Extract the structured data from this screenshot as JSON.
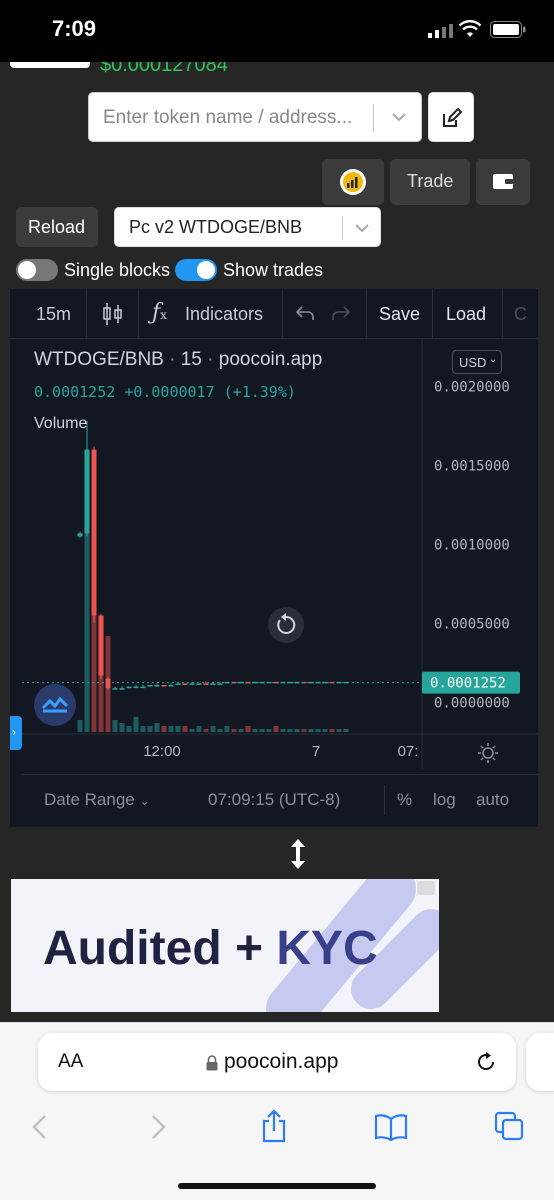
{
  "status_bar": {
    "time": "7:09"
  },
  "header": {
    "token_price": "$0.000127084",
    "search_placeholder": "Enter token name / address..."
  },
  "controls": {
    "trade_label": "Trade",
    "reload_label": "Reload",
    "pair_select": "Pc v2 WTDOGE/BNB",
    "single_blocks_label": "Single blocks",
    "single_blocks_on": false,
    "show_trades_label": "Show trades",
    "show_trades_on": true
  },
  "chart_toolbar": {
    "interval": "15m",
    "indicators_label": "Indicators",
    "save_label": "Save",
    "load_label": "Load",
    "overflow_letter": "C"
  },
  "chart_legend": {
    "symbol": "WTDOGE/BNB",
    "dot1": "·",
    "interval": "15",
    "dot2": "·",
    "source": "poocoin.app",
    "price": "0.0001252",
    "change": "+0.0000017",
    "change_pct": "(+1.39%)",
    "volume_label": "Volume",
    "currency_button": "USD"
  },
  "chart_data": {
    "type": "candlestick",
    "y_ticks": [
      "0.0020000",
      "0.0015000",
      "0.0010000",
      "0.0005000",
      "0.0000000"
    ],
    "current_price_label": "0.0001252",
    "x_tick_labels": [
      "12:00",
      "7",
      "07:"
    ],
    "ylim": [
      -0.0002,
      0.0023
    ],
    "candles": [
      {
        "o": 0.00105,
        "c": 0.00107,
        "h": 0.00108,
        "l": 0.00104,
        "up": true
      },
      {
        "o": 0.00107,
        "c": 0.0016,
        "h": 0.00178,
        "l": 0.00105,
        "up": true
      },
      {
        "o": 0.0016,
        "c": 0.00055,
        "h": 0.00162,
        "l": 0.0005,
        "up": false
      },
      {
        "o": 0.00055,
        "c": 0.00017,
        "h": 0.00056,
        "l": 0.00015,
        "up": false
      },
      {
        "o": 0.00015,
        "c": 9e-05,
        "h": 0.00016,
        "l": 8e-05,
        "up": false
      },
      {
        "o": 9e-05,
        "c": 9e-05,
        "h": 0.0001,
        "l": 8e-05,
        "up": true
      },
      {
        "o": 9e-05,
        "c": 9e-05,
        "h": 0.0001,
        "l": 8e-05,
        "up": true
      },
      {
        "o": 9e-05,
        "c": 0.0001,
        "h": 0.0001,
        "l": 9e-05,
        "up": true
      },
      {
        "o": 0.0001,
        "c": 0.0001,
        "h": 0.00011,
        "l": 9e-05,
        "up": true
      },
      {
        "o": 0.0001,
        "c": 0.0001,
        "h": 0.00011,
        "l": 0.0001,
        "up": true
      },
      {
        "o": 0.0001,
        "c": 0.00011,
        "h": 0.00011,
        "l": 0.0001,
        "up": true
      },
      {
        "o": 0.00011,
        "c": 0.00011,
        "h": 0.00012,
        "l": 0.0001,
        "up": true
      },
      {
        "o": 0.00011,
        "c": 0.00011,
        "h": 0.00011,
        "l": 0.0001,
        "up": false
      },
      {
        "o": 0.00011,
        "c": 0.00011,
        "h": 0.00012,
        "l": 0.00011,
        "up": true
      },
      {
        "o": 0.00011,
        "c": 0.00012,
        "h": 0.00012,
        "l": 0.00011,
        "up": true
      },
      {
        "o": 0.00012,
        "c": 0.00012,
        "h": 0.00012,
        "l": 0.00011,
        "up": false
      },
      {
        "o": 0.00012,
        "c": 0.00012,
        "h": 0.00013,
        "l": 0.00011,
        "up": true
      },
      {
        "o": 0.00012,
        "c": 0.00012,
        "h": 0.00012,
        "l": 0.00012,
        "up": true
      },
      {
        "o": 0.00012,
        "c": 0.00012,
        "h": 0.00013,
        "l": 0.00012,
        "up": false
      },
      {
        "o": 0.00012,
        "c": 0.00012,
        "h": 0.00013,
        "l": 0.00012,
        "up": true
      },
      {
        "o": 0.00012,
        "c": 0.00012,
        "h": 0.00013,
        "l": 0.00012,
        "up": true
      },
      {
        "o": 0.00012,
        "c": 0.00013,
        "h": 0.00013,
        "l": 0.00012,
        "up": true
      },
      {
        "o": 0.00013,
        "c": 0.00013,
        "h": 0.00013,
        "l": 0.00012,
        "up": false
      },
      {
        "o": 0.00013,
        "c": 0.00013,
        "h": 0.00013,
        "l": 0.00012,
        "up": true
      },
      {
        "o": 0.00013,
        "c": 0.00013,
        "h": 0.00013,
        "l": 0.00012,
        "up": false
      },
      {
        "o": 0.00013,
        "c": 0.00013,
        "h": 0.00013,
        "l": 0.00012,
        "up": true
      },
      {
        "o": 0.00013,
        "c": 0.00013,
        "h": 0.00013,
        "l": 0.00012,
        "up": true
      },
      {
        "o": 0.00013,
        "c": 0.00013,
        "h": 0.00013,
        "l": 0.00013,
        "up": true
      },
      {
        "o": 0.00013,
        "c": 0.00013,
        "h": 0.00013,
        "l": 0.00012,
        "up": false
      },
      {
        "o": 0.00013,
        "c": 0.00013,
        "h": 0.00013,
        "l": 0.00012,
        "up": true
      },
      {
        "o": 0.00013,
        "c": 0.00013,
        "h": 0.00013,
        "l": 0.00013,
        "up": true
      },
      {
        "o": 0.00013,
        "c": 0.00013,
        "h": 0.00013,
        "l": 0.00013,
        "up": true
      },
      {
        "o": 0.00013,
        "c": 0.00013,
        "h": 0.00013,
        "l": 0.00012,
        "up": false
      },
      {
        "o": 0.00013,
        "c": 0.00013,
        "h": 0.00013,
        "l": 0.00013,
        "up": true
      },
      {
        "o": 0.00013,
        "c": 0.00013,
        "h": 0.00013,
        "l": 0.00013,
        "up": true
      },
      {
        "o": 0.00013,
        "c": 0.00013,
        "h": 0.00013,
        "l": 0.00013,
        "up": true
      },
      {
        "o": 0.00013,
        "c": 0.00013,
        "h": 0.00013,
        "l": 0.00013,
        "up": false
      },
      {
        "o": 0.00013,
        "c": 0.00013,
        "h": 0.00013,
        "l": 0.00013,
        "up": true
      },
      {
        "o": 0.00013,
        "c": 0.00013,
        "h": 0.00013,
        "l": 0.00013,
        "up": true
      }
    ],
    "volumes": [
      0.04,
      0.75,
      0.55,
      0.38,
      0.32,
      0.04,
      0.03,
      0.02,
      0.05,
      0.02,
      0.02,
      0.03,
      0.02,
      0.02,
      0.02,
      0.02,
      0.01,
      0.02,
      0.01,
      0.02,
      0.01,
      0.02,
      0.01,
      0.01,
      0.02,
      0.01,
      0.01,
      0.01,
      0.02,
      0.01,
      0.01,
      0.01,
      0.01,
      0.01,
      0.01,
      0.01,
      0.01,
      0.01,
      0.01
    ],
    "up_color": "#26a69a",
    "down_color": "#ef5350",
    "last_price_color": "#26a69a"
  },
  "chart_bottom": {
    "date_range": "Date Range",
    "time": "07:09:15 (UTC-8)",
    "percent": "%",
    "log": "log",
    "auto": "auto"
  },
  "ad": {
    "text_main": "Audited",
    "text_plus": "+",
    "text_kyc": "KYC"
  },
  "browser": {
    "aa_label": "AA",
    "url": "poocoin.app"
  },
  "colors": {
    "accent_blue": "#2196f3",
    "green_price": "#32c35a",
    "app_bg": "#262626",
    "chart_bg": "#131722"
  }
}
